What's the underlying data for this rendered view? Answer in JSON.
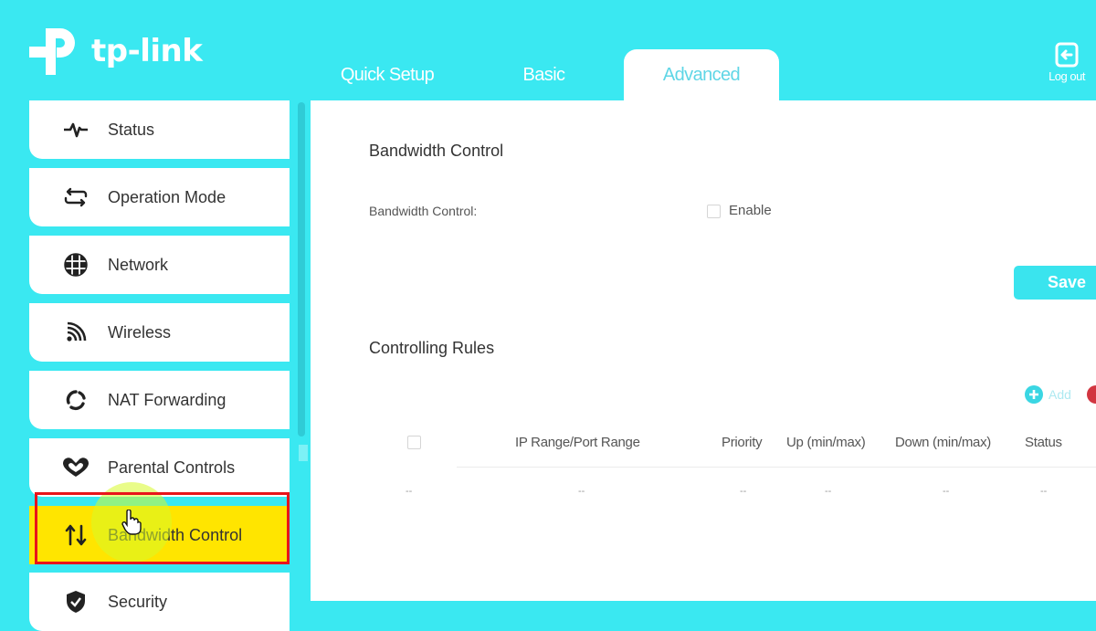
{
  "brand": {
    "name": "tp-link",
    "accent_color": "#3ae8f1",
    "highlight_color": "#ffe500",
    "annotation_color": "#e8151b"
  },
  "header": {
    "tabs": [
      {
        "label": "Quick Setup",
        "active": false
      },
      {
        "label": "Basic",
        "active": false
      },
      {
        "label": "Advanced",
        "active": true
      }
    ],
    "logout": {
      "label": "Log out",
      "icon": "logout-icon"
    }
  },
  "sidebar": {
    "items": [
      {
        "label": "Status",
        "icon": "pulse-icon",
        "active": false
      },
      {
        "label": "Operation Mode",
        "icon": "swap-icon",
        "active": false
      },
      {
        "label": "Network",
        "icon": "globe-icon",
        "active": false
      },
      {
        "label": "Wireless",
        "icon": "wifi-icon",
        "active": false
      },
      {
        "label": "NAT Forwarding",
        "icon": "nat-cycle-icon",
        "active": false
      },
      {
        "label": "Parental Controls",
        "icon": "heart-icon",
        "active": false
      },
      {
        "label": "Bandwidth Control",
        "icon": "up-down-arrows-icon",
        "active": true
      },
      {
        "label": "Security",
        "icon": "shield-check-icon",
        "active": false
      }
    ]
  },
  "main": {
    "bandwidth_section": {
      "title": "Bandwidth Control",
      "field_label": "Bandwidth Control:",
      "enable_label": "Enable",
      "enabled": false,
      "save_label": "Save"
    },
    "rules_section": {
      "title": "Controlling Rules",
      "add_label": "Add",
      "columns": [
        "IP Range/Port Range",
        "Priority",
        "Up (min/max)",
        "Down (min/max)",
        "Status"
      ],
      "rows": [
        {
          "select": "--",
          "ip_range": "--",
          "priority": "--",
          "up": "--",
          "down": "--",
          "status": "--"
        }
      ]
    }
  }
}
